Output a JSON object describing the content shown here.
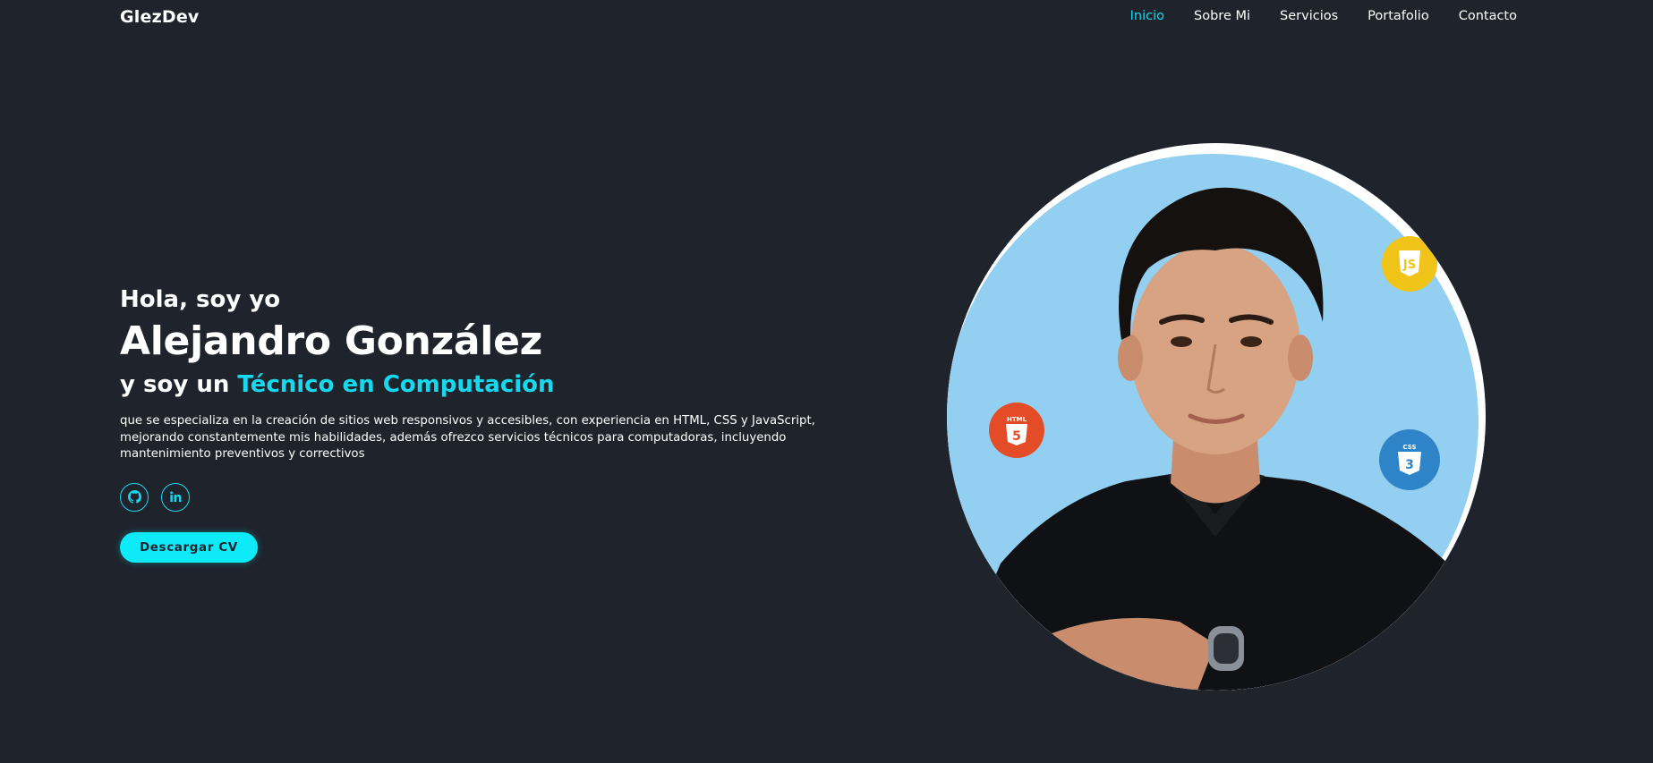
{
  "header": {
    "logo": "GlezDev",
    "nav": [
      {
        "label": "Inicio",
        "active": true
      },
      {
        "label": "Sobre Mi",
        "active": false
      },
      {
        "label": "Servicios",
        "active": false
      },
      {
        "label": "Portafolio",
        "active": false
      },
      {
        "label": "Contacto",
        "active": false
      }
    ]
  },
  "hero": {
    "greeting": "Hola, soy yo",
    "name": "Alejandro González",
    "role_prefix": "y soy un ",
    "role_highlight": "Técnico en Computación",
    "description": "que se especializa en la creación de sitios web responsivos y accesibles, con experiencia en HTML, CSS y JavaScript, mejorando constantemente mis habilidades, además ofrezco servicios técnicos para computadoras, incluyendo mantenimiento preventivos y correctivos",
    "socials": [
      {
        "name": "github-icon"
      },
      {
        "name": "linkedin-icon"
      }
    ],
    "cv_button": "Descargar CV"
  },
  "badges": {
    "html": "HTML",
    "css": "CSS",
    "js": "JS"
  },
  "colors": {
    "background": "#1f232c",
    "accent": "#18d8ee",
    "button": "#0eeaf8",
    "portrait_bg": "#93cff0"
  }
}
